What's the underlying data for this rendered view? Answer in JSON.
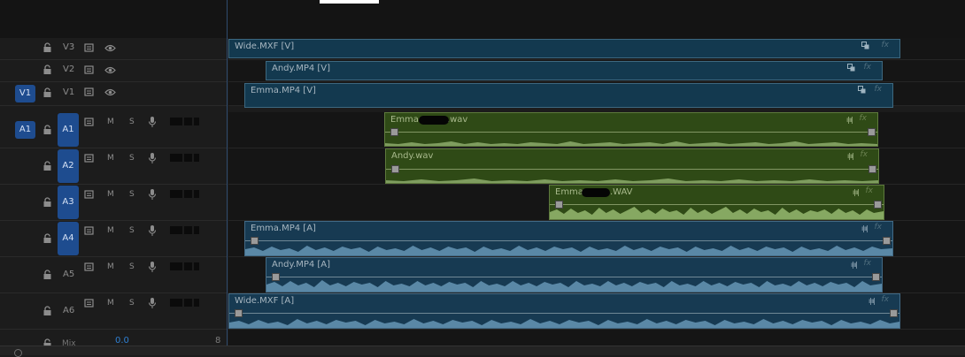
{
  "colors": {
    "video_clip": "#13394f",
    "audio_clip_green": "#2f4a16",
    "audio_clip_blue": "#173a52",
    "toggle_blue": "#1e4c8f"
  },
  "tracks": {
    "v3": {
      "label": "V3"
    },
    "v2": {
      "label": "V2"
    },
    "v1": {
      "label": "V1",
      "source": "V1"
    },
    "a1": {
      "label": "A1",
      "source": "A1",
      "m": "M",
      "s": "S"
    },
    "a2": {
      "label": "A2",
      "m": "M",
      "s": "S"
    },
    "a3": {
      "label": "A3",
      "m": "M",
      "s": "S"
    },
    "a4": {
      "label": "A4",
      "m": "M",
      "s": "S"
    },
    "a5": {
      "label": "A5",
      "m": "M",
      "s": "S"
    },
    "a6": {
      "label": "A6",
      "m": "M",
      "s": "S"
    }
  },
  "mix": {
    "label": "Mix",
    "value": "0.0",
    "end_glyph": "8"
  },
  "clips": {
    "wide_v": {
      "name": "Wide.MXF [V]",
      "fx": "fx"
    },
    "andy_v": {
      "name": "Andy.MP4 [V]",
      "fx": "fx"
    },
    "emma_v": {
      "name": "Emma.MP4 [V]",
      "fx": "fx"
    },
    "emma_wav": {
      "name_start": "Emma",
      "name_end": ".wav",
      "fx": "fx"
    },
    "andy_wav": {
      "name": "Andy.wav",
      "fx": "fx"
    },
    "emma_wav2": {
      "name_start": "Emma",
      "name_end": ".WAV",
      "fx": "fx"
    },
    "emma_a": {
      "name": "Emma.MP4 [A]",
      "fx": "fx"
    },
    "andy_a": {
      "name": "Andy.MP4 [A]",
      "fx": "fx"
    },
    "wide_a": {
      "name": "Wide.MXF [A]",
      "fx": "fx"
    }
  }
}
